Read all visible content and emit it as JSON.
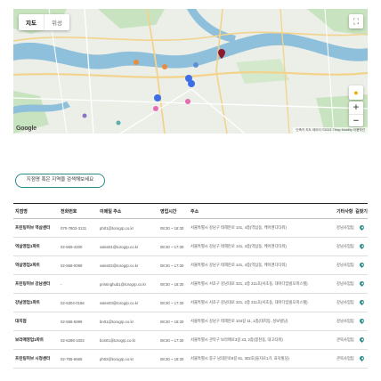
{
  "map": {
    "type_tabs": [
      "지도",
      "위성"
    ],
    "google_logo": "Google",
    "footer": "단축키  지도 데이터 ©2023 TMap Mobility  이용약관",
    "fullscreen_icon": "fullscreen-icon",
    "zoom_in": "+",
    "zoom_out": "−",
    "pegman_icon": "street-view-icon"
  },
  "search": {
    "label": "지점명 혹은 지역을 검색해보세요"
  },
  "table": {
    "headers": [
      "지점명",
      "전화번호",
      "이메일 주소",
      "영업시간",
      "주소",
      "기타사항",
      "길찾기"
    ],
    "rows": [
      {
        "name": "프린팅허브 역삼센터",
        "tel": "070-7803-3131",
        "email": "ph01@torogrp.co.kr",
        "hours": "08:30 ~ 18:30",
        "addr": "서울특별시 강남구 테헤란로 141, 4층(역삼동, 케이앤디타워)",
        "etc": "강남사업팀"
      },
      {
        "name": "역삼영업1파트",
        "tel": "02-569-4200",
        "email": "sales01@torogrp.co.kr",
        "hours": "08:30 ~ 17:30",
        "addr": "서울특별시 강남구 테헤란로 141, 4층(역삼동, 케이앤디타워)",
        "etc": "강남사업팀"
      },
      {
        "name": "역삼영업2파트",
        "tel": "02-558-0099",
        "email": "sales02@torogrp.co.kr",
        "hours": "08:30 ~ 17:30",
        "addr": "서울특별시 강남구 테헤란로 141, 4층(역삼동, 케이앤디타워)",
        "etc": "강남사업팀"
      },
      {
        "name": "프린팅허브 강남센터",
        "tel": "-",
        "email": "printinghub1@torogrp.co.kr",
        "hours": "08:30 ~ 18:30",
        "addr": "서울특별시 서초구 강남대로 321, 2층 211호(서초동, 대아다임빌오피스텔)",
        "etc": "강남사업팀"
      },
      {
        "name": "강남영업1파트",
        "tel": "02-6304-0156",
        "email": "sales03@torogrp.co.kr",
        "hours": "08:30 ~ 17:30",
        "addr": "서울특별시 서초구 강남대로 321, 2층 211호(서초동, 대아다임빌오피스텔)",
        "etc": "강남사업팀"
      },
      {
        "name": "대치점",
        "tel": "02-558-5999",
        "email": "bn01@torogrp.co.kr",
        "hours": "08:30 ~ 18:30",
        "addr": "서울특별시 강남구 테헤란로 104길 11, 1층(대치동, 성보빌딩)",
        "etc": "강남사업팀"
      },
      {
        "name": "보라매영업1파트",
        "tel": "02-6288-1002",
        "email": "bos01@torogrp.co.kr",
        "hours": "08:30 ~ 17:30",
        "addr": "서울특별시 관악구 보라매로3길 23, 2층(봉천동, 대고타워)",
        "etc": "관북사업팀"
      },
      {
        "name": "프린팅허브 시청센터",
        "tel": "02-755-6665",
        "email": "ph02@torogrp.co.kr",
        "hours": "08:30 ~ 18:30",
        "addr": "서울특별시 중구 남대문로9길 51, 302호(을지로1가, 효덕빌딩)",
        "etc": "관북사업팀"
      }
    ]
  },
  "colors": {
    "accent": "#2d8a8a",
    "river": "#8fc0db",
    "park": "#b6dbb0",
    "road": "#f3d38c"
  }
}
